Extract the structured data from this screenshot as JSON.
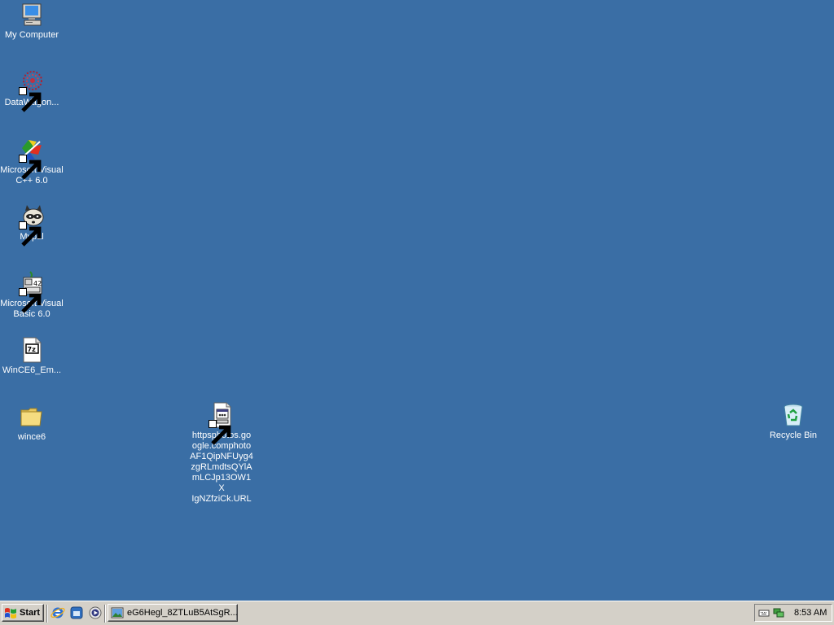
{
  "desktop": {
    "background_color": "#3a6ea5",
    "icons": [
      {
        "id": "my-computer",
        "label": "My Computer",
        "icon": "computer-icon"
      },
      {
        "id": "datawagon",
        "label": "DataWagon...",
        "icon": "datawagon-icon",
        "shortcut": true
      },
      {
        "id": "msvc",
        "label": "Microsoft Visual\nC++ 6.0",
        "icon": "visual-cpp-icon",
        "shortcut": true
      },
      {
        "id": "mypal",
        "label": "Mypal",
        "icon": "raccoon-icon",
        "shortcut": true
      },
      {
        "id": "msvb",
        "label": "Microsoft Visual\nBasic 6.0",
        "icon": "visual-basic-icon",
        "shortcut": true
      },
      {
        "id": "wince6-archive",
        "label": "WinCE6_Em...",
        "icon": "7z-archive-icon"
      },
      {
        "id": "wince6-folder",
        "label": "wince6",
        "icon": "folder-icon"
      },
      {
        "id": "url-shortcut",
        "label": "httpsphotos.go\nogle.comphoto\nAF1QipNFUyg4\nzgRLmdtsQYlA\nmLCJp13OW1X\nIgNZfziCk.URL",
        "icon": "url-file-icon",
        "shortcut": true
      },
      {
        "id": "recycle-bin",
        "label": "Recycle Bin",
        "icon": "recycle-bin-icon"
      }
    ]
  },
  "taskbar": {
    "start_label": "Start",
    "quick_launch": [
      {
        "icon": "internet-explorer-icon"
      },
      {
        "icon": "show-desktop-icon"
      },
      {
        "icon": "media-player-icon"
      }
    ],
    "task_button_label": "eG6Hegl_8ZTLuB5AtSgR...",
    "tray": {
      "icons": [
        "keyboard-icon",
        "network-icon"
      ],
      "clock": "8:53 AM"
    }
  }
}
